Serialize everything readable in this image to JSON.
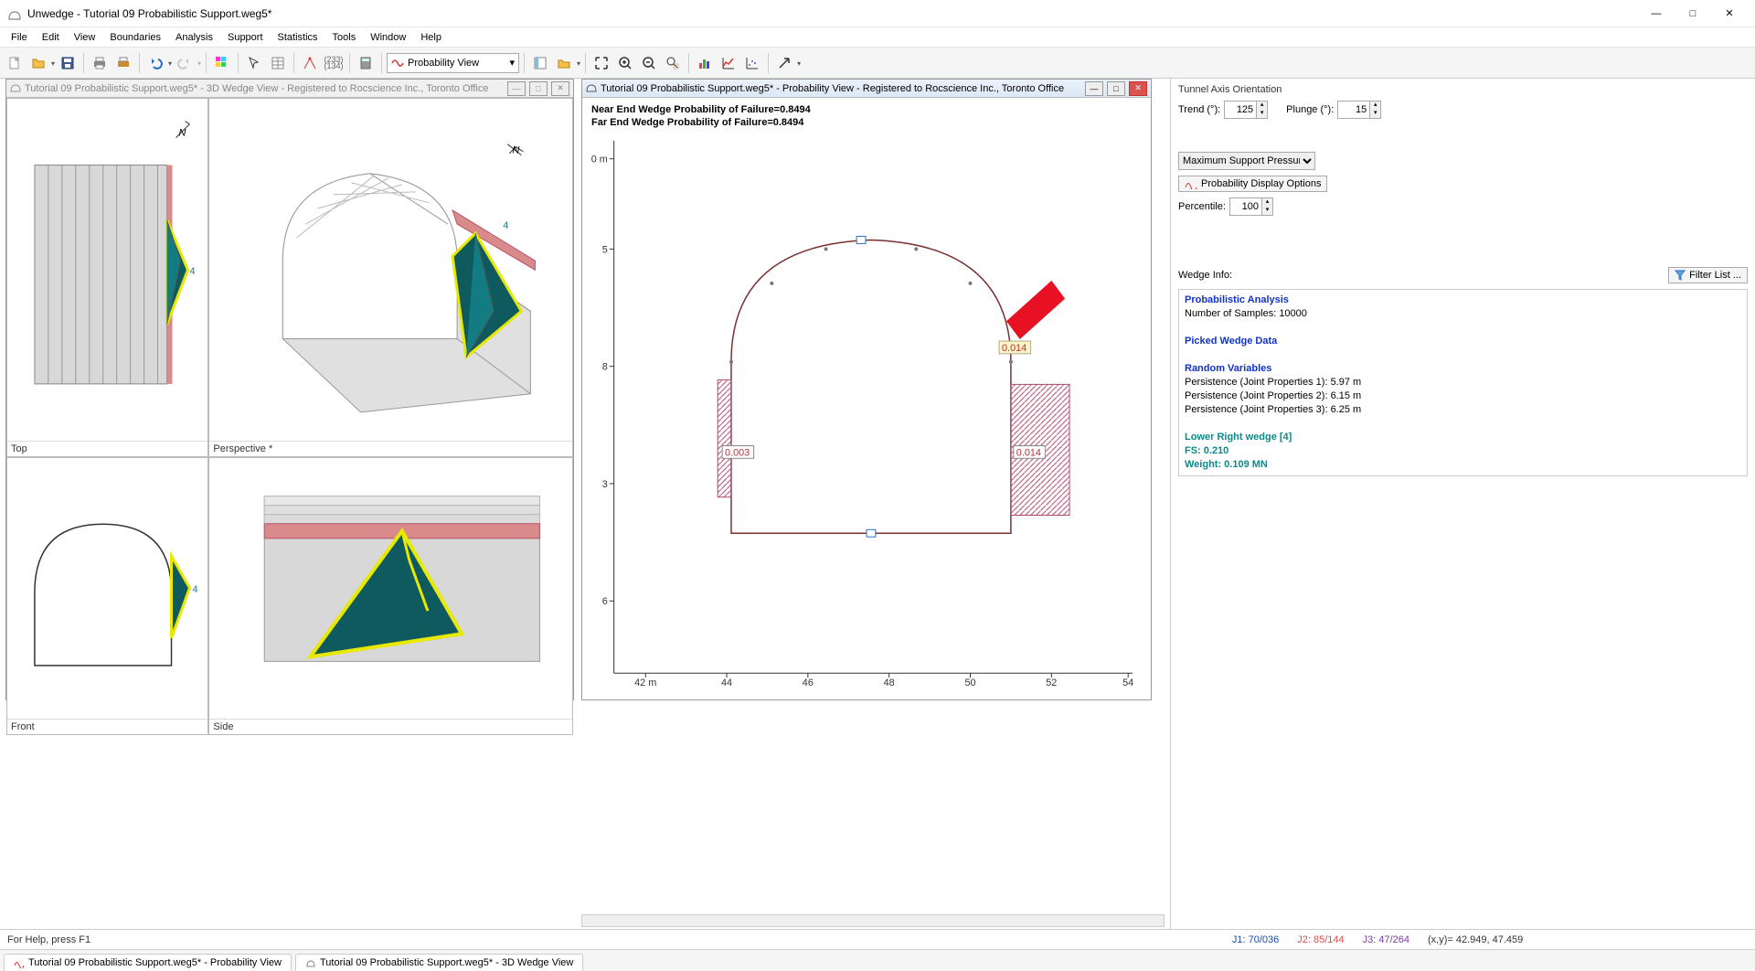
{
  "app": {
    "title": "Unwedge - Tutorial 09 Probabilistic Support.weg5*"
  },
  "menu": [
    "File",
    "Edit",
    "View",
    "Boundaries",
    "Analysis",
    "Support",
    "Statistics",
    "Tools",
    "Window",
    "Help"
  ],
  "toolbar": {
    "view_select": "Probability View"
  },
  "mdi": {
    "left_title": "Tutorial 09 Probabilistic Support.weg5* - 3D Wedge View - Registered to Rocscience Inc., Toronto Office",
    "right_title": "Tutorial 09 Probabilistic Support.weg5* - Probability View - Registered to Rocscience Inc., Toronto Office",
    "views": {
      "top": "Top",
      "perspective": "Perspective *",
      "front": "Front",
      "side": "Side"
    },
    "wedge_num": "4"
  },
  "plot": {
    "near_text": "Near End Wedge Probability of Failure=0.8494",
    "far_text": "Far End Wedge Probability of Failure=0.8494",
    "labels": {
      "left": "0.003",
      "upper_right": "0.014",
      "lower_right": "0.014"
    },
    "x_ticks": [
      "42 m",
      "44",
      "46",
      "48",
      "50",
      "52",
      "54"
    ],
    "y_ticks": [
      "0 m",
      "5",
      "8",
      "3",
      "6"
    ]
  },
  "sidebar": {
    "orientation_title": "Tunnel Axis Orientation",
    "trend_label": "Trend (°):",
    "trend_value": "125",
    "plunge_label": "Plunge (°):",
    "plunge_value": "15",
    "pressure_select": "Maximum Support Pressure",
    "prob_options_btn": "Probability Display Options",
    "percentile_label": "Percentile:",
    "percentile_value": "100",
    "wedge_info_label": "Wedge Info:",
    "filter_btn": "Filter List ...",
    "info": {
      "h1": "Probabilistic Analysis",
      "samples": "Number of Samples:  10000",
      "h2": "Picked Wedge Data",
      "h3": "Random Variables",
      "p1": "Persistence (Joint Properties 1): 5.97 m",
      "p2": "Persistence (Joint Properties 2): 6.15 m",
      "p3": "Persistence (Joint Properties 3): 6.25 m",
      "w1": "Lower Right wedge [4]",
      "w2": "FS: 0.210",
      "w3": "Weight: 0.109 MN"
    }
  },
  "status": {
    "help": "For Help, press F1",
    "j1": "J1: 70/036",
    "j2": "J2: 85/144",
    "j3": "J3: 47/264",
    "coords": "(x,y)= 42.949, 47.459"
  },
  "tabs": {
    "t1": "Tutorial 09 Probabilistic Support.weg5* - Probability View",
    "t2": "Tutorial 09 Probabilistic Support.weg5* - 3D Wedge View"
  },
  "chart_data": {
    "type": "diagram",
    "tunnel_section": {
      "x_range_m": [
        42,
        54
      ],
      "wedge_pressures": [
        {
          "side": "left",
          "y_m_approx": 4.6,
          "value": 0.003
        },
        {
          "side": "upper_right",
          "y_m_approx": 7.0,
          "value": 0.014
        },
        {
          "side": "lower_right",
          "y_m_approx": 4.6,
          "value": 0.014
        }
      ],
      "near_end_prob_failure": 0.8494,
      "far_end_prob_failure": 0.8494
    }
  }
}
